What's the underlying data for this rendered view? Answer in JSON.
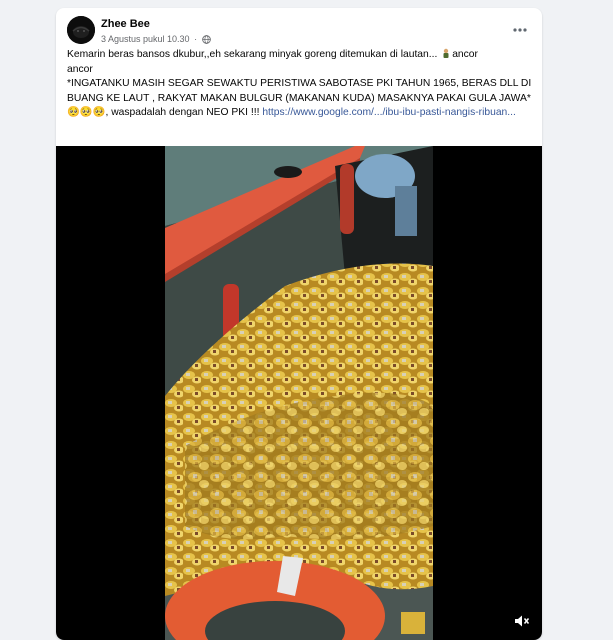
{
  "post": {
    "author": "Zhee Bee",
    "timestamp": "3 Agustus pukul 10.30",
    "separator": "·",
    "privacy_icon": "globe-icon",
    "more_icon": "more-horizontal-icon",
    "line1_before_emoji": "Kemarin beras bansos dkubur,,eh sekarang minyak goreng ditemukan di lautan... ",
    "line1_after_emoji": "ancor",
    "line2": "ancor",
    "body_text": "*INGATANKU MASIH SEGAR SEWAKTU PERISTIWA SABOTASE PKI TAHUN 1965, BERAS DLL DI BUANG KE LAUT , RAKYAT MAKAN BULGUR (MAKANAN KUDA) MASAKNYA PAKAI GULA JAWA* ",
    "emoji_sequence": "🥺🥺🥺",
    "body_tail": ", waspadalah dengan NEO PKI !!! ",
    "link_text": "https://www.google.com/.../ibu-ibu-pasti-nangis-ribuan..."
  },
  "video": {
    "mute_icon": "volume-muted-icon"
  },
  "colors": {
    "link": "#385898",
    "background": "#f0f2f5",
    "card": "#ffffff",
    "boat_rail": "#e05a3f",
    "oil_packets": "#d9b23a",
    "sea": "#4a6a66"
  }
}
